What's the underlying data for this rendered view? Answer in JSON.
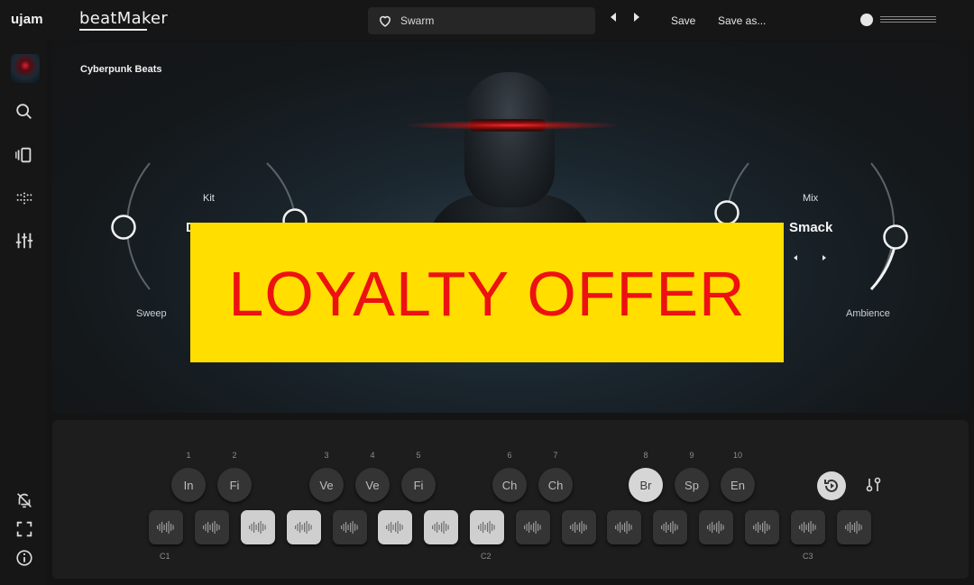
{
  "app": {
    "brand": "ujam",
    "product": "beatMaker"
  },
  "header": {
    "preset_name": "Swarm",
    "save_label": "Save",
    "save_as_label": "Save as...",
    "icons": [
      "heart-icon",
      "arrow-left-icon",
      "arrow-right-icon",
      "volume-knob-icon"
    ]
  },
  "sidebar": {
    "icons": [
      "avatar",
      "search-icon",
      "library-icon",
      "pattern-icon",
      "mixer-icon",
      "notification-off-icon",
      "fullscreen-icon",
      "info-icon"
    ]
  },
  "hero": {
    "title": "Cyberpunk Beats",
    "kit_label": "Kit",
    "kit_value": "D",
    "mix_label": "Mix",
    "mix_value": "Smack",
    "sweep_label": "Sweep",
    "ambience_label": "Ambience"
  },
  "overlay": {
    "text": "LOYALTY OFFER",
    "background": "#ffde00",
    "color": "#ee1111"
  },
  "styles": {
    "numbers": [
      "1",
      "2",
      "3",
      "4",
      "5",
      "6",
      "7",
      "8",
      "9",
      "10"
    ],
    "buttons": [
      {
        "label": "In",
        "number": "1"
      },
      {
        "label": "Fi",
        "number": "2"
      },
      {
        "label": "Ve",
        "number": "3"
      },
      {
        "label": "Ve",
        "number": "4"
      },
      {
        "label": "Fi",
        "number": "5"
      },
      {
        "label": "Ch",
        "number": "6"
      },
      {
        "label": "Ch",
        "number": "7"
      },
      {
        "label": "Br",
        "number": "8",
        "active": true
      },
      {
        "label": "Sp",
        "number": "9"
      },
      {
        "label": "En",
        "number": "10"
      }
    ]
  },
  "pads": {
    "lit": [
      false,
      false,
      true,
      true,
      false,
      true,
      true,
      true,
      false,
      false,
      false,
      false,
      false,
      false,
      false,
      false
    ],
    "octave_labels": [
      "C1",
      "C2",
      "C3"
    ]
  },
  "colors": {
    "accent": "#ffde00",
    "offer_text": "#ee1111",
    "panel": "#1d1d1d"
  }
}
